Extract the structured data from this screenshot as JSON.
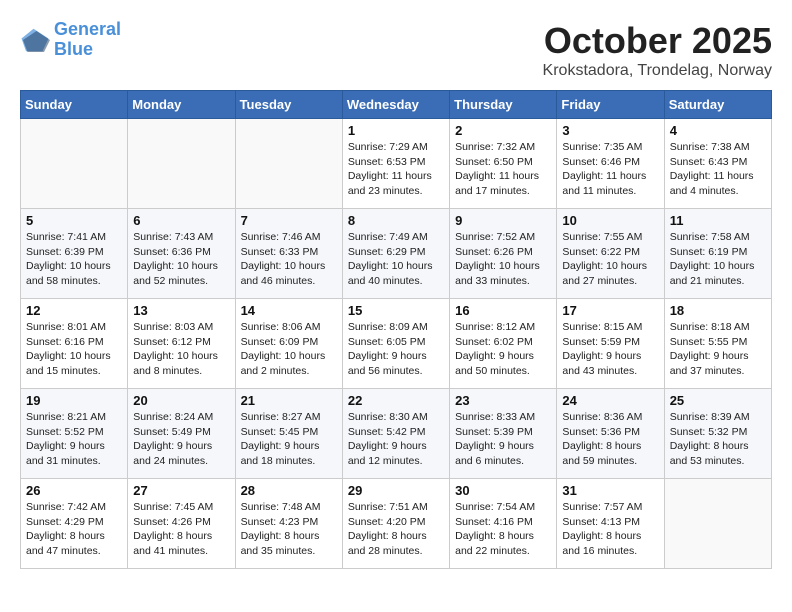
{
  "header": {
    "logo_line1": "General",
    "logo_line2": "Blue",
    "month": "October 2025",
    "location": "Krokstadora, Trondelag, Norway"
  },
  "weekdays": [
    "Sunday",
    "Monday",
    "Tuesday",
    "Wednesday",
    "Thursday",
    "Friday",
    "Saturday"
  ],
  "weeks": [
    [
      {
        "day": "",
        "info": ""
      },
      {
        "day": "",
        "info": ""
      },
      {
        "day": "",
        "info": ""
      },
      {
        "day": "1",
        "info": "Sunrise: 7:29 AM\nSunset: 6:53 PM\nDaylight: 11 hours\nand 23 minutes."
      },
      {
        "day": "2",
        "info": "Sunrise: 7:32 AM\nSunset: 6:50 PM\nDaylight: 11 hours\nand 17 minutes."
      },
      {
        "day": "3",
        "info": "Sunrise: 7:35 AM\nSunset: 6:46 PM\nDaylight: 11 hours\nand 11 minutes."
      },
      {
        "day": "4",
        "info": "Sunrise: 7:38 AM\nSunset: 6:43 PM\nDaylight: 11 hours\nand 4 minutes."
      }
    ],
    [
      {
        "day": "5",
        "info": "Sunrise: 7:41 AM\nSunset: 6:39 PM\nDaylight: 10 hours\nand 58 minutes."
      },
      {
        "day": "6",
        "info": "Sunrise: 7:43 AM\nSunset: 6:36 PM\nDaylight: 10 hours\nand 52 minutes."
      },
      {
        "day": "7",
        "info": "Sunrise: 7:46 AM\nSunset: 6:33 PM\nDaylight: 10 hours\nand 46 minutes."
      },
      {
        "day": "8",
        "info": "Sunrise: 7:49 AM\nSunset: 6:29 PM\nDaylight: 10 hours\nand 40 minutes."
      },
      {
        "day": "9",
        "info": "Sunrise: 7:52 AM\nSunset: 6:26 PM\nDaylight: 10 hours\nand 33 minutes."
      },
      {
        "day": "10",
        "info": "Sunrise: 7:55 AM\nSunset: 6:22 PM\nDaylight: 10 hours\nand 27 minutes."
      },
      {
        "day": "11",
        "info": "Sunrise: 7:58 AM\nSunset: 6:19 PM\nDaylight: 10 hours\nand 21 minutes."
      }
    ],
    [
      {
        "day": "12",
        "info": "Sunrise: 8:01 AM\nSunset: 6:16 PM\nDaylight: 10 hours\nand 15 minutes."
      },
      {
        "day": "13",
        "info": "Sunrise: 8:03 AM\nSunset: 6:12 PM\nDaylight: 10 hours\nand 8 minutes."
      },
      {
        "day": "14",
        "info": "Sunrise: 8:06 AM\nSunset: 6:09 PM\nDaylight: 10 hours\nand 2 minutes."
      },
      {
        "day": "15",
        "info": "Sunrise: 8:09 AM\nSunset: 6:05 PM\nDaylight: 9 hours\nand 56 minutes."
      },
      {
        "day": "16",
        "info": "Sunrise: 8:12 AM\nSunset: 6:02 PM\nDaylight: 9 hours\nand 50 minutes."
      },
      {
        "day": "17",
        "info": "Sunrise: 8:15 AM\nSunset: 5:59 PM\nDaylight: 9 hours\nand 43 minutes."
      },
      {
        "day": "18",
        "info": "Sunrise: 8:18 AM\nSunset: 5:55 PM\nDaylight: 9 hours\nand 37 minutes."
      }
    ],
    [
      {
        "day": "19",
        "info": "Sunrise: 8:21 AM\nSunset: 5:52 PM\nDaylight: 9 hours\nand 31 minutes."
      },
      {
        "day": "20",
        "info": "Sunrise: 8:24 AM\nSunset: 5:49 PM\nDaylight: 9 hours\nand 24 minutes."
      },
      {
        "day": "21",
        "info": "Sunrise: 8:27 AM\nSunset: 5:45 PM\nDaylight: 9 hours\nand 18 minutes."
      },
      {
        "day": "22",
        "info": "Sunrise: 8:30 AM\nSunset: 5:42 PM\nDaylight: 9 hours\nand 12 minutes."
      },
      {
        "day": "23",
        "info": "Sunrise: 8:33 AM\nSunset: 5:39 PM\nDaylight: 9 hours\nand 6 minutes."
      },
      {
        "day": "24",
        "info": "Sunrise: 8:36 AM\nSunset: 5:36 PM\nDaylight: 8 hours\nand 59 minutes."
      },
      {
        "day": "25",
        "info": "Sunrise: 8:39 AM\nSunset: 5:32 PM\nDaylight: 8 hours\nand 53 minutes."
      }
    ],
    [
      {
        "day": "26",
        "info": "Sunrise: 7:42 AM\nSunset: 4:29 PM\nDaylight: 8 hours\nand 47 minutes."
      },
      {
        "day": "27",
        "info": "Sunrise: 7:45 AM\nSunset: 4:26 PM\nDaylight: 8 hours\nand 41 minutes."
      },
      {
        "day": "28",
        "info": "Sunrise: 7:48 AM\nSunset: 4:23 PM\nDaylight: 8 hours\nand 35 minutes."
      },
      {
        "day": "29",
        "info": "Sunrise: 7:51 AM\nSunset: 4:20 PM\nDaylight: 8 hours\nand 28 minutes."
      },
      {
        "day": "30",
        "info": "Sunrise: 7:54 AM\nSunset: 4:16 PM\nDaylight: 8 hours\nand 22 minutes."
      },
      {
        "day": "31",
        "info": "Sunrise: 7:57 AM\nSunset: 4:13 PM\nDaylight: 8 hours\nand 16 minutes."
      },
      {
        "day": "",
        "info": ""
      }
    ]
  ]
}
